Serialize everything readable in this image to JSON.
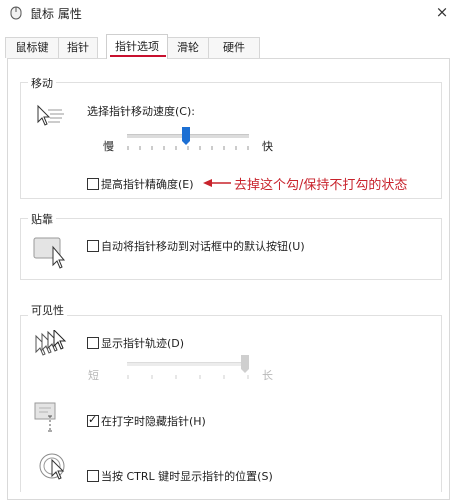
{
  "window": {
    "title": "鼠标 属性",
    "close_glyph": "×"
  },
  "tabs": [
    {
      "label": "鼠标键",
      "active": false
    },
    {
      "label": "指针",
      "active": false
    },
    {
      "label": "指针选项",
      "active": true
    },
    {
      "label": "滑轮",
      "active": false
    },
    {
      "label": "硬件",
      "active": false
    }
  ],
  "motion": {
    "group_label": "移动",
    "speed_label": "选择指针移动速度(C):",
    "slow_label": "慢",
    "fast_label": "快",
    "speed_level_fraction": 0.5,
    "precision_label": "提高指针精确度(E)",
    "precision_checked": false,
    "icon": "pointer-speed-icon"
  },
  "annotation": {
    "text": "去掉这个勾/保持不打勾的状态",
    "color": "#c8232c"
  },
  "snap_to": {
    "group_label": "贴靠",
    "label": "自动将指针移动到对话框中的默认按钮(U)",
    "checked": false,
    "icon": "snap-to-default-icon"
  },
  "visibility": {
    "group_label": "可见性",
    "trails_label": "显示指针轨迹(D)",
    "trails_checked": false,
    "short_label": "短",
    "long_label": "长",
    "trail_length_fraction": 1.0,
    "hide_typing_label": "在打字时隐藏指针(H)",
    "hide_typing_checked": true,
    "ctrl_label": "当按 CTRL 键时显示指针的位置(S)",
    "ctrl_checked": false
  },
  "colors": {
    "accent_blue": "#1c6fd3",
    "tab_underline": "#c8102e"
  }
}
